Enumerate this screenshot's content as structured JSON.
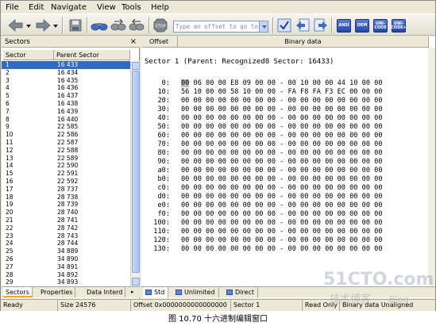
{
  "menu": {
    "file": "File",
    "edit": "Edit",
    "navigate": "Navigate",
    "view": "View",
    "tools": "Tools",
    "help": "Help"
  },
  "toolbar": {
    "offset_placeholder": "Type an offset to go to",
    "stop_label": "STOP",
    "enc_ansi": "ANSI",
    "enc_oem": "OEM",
    "enc_uni": "UNI-CODE",
    "enc_uni2": "UNI-CODE+"
  },
  "left_panel": {
    "title": "Sectors",
    "close_glyph": "×",
    "col_sector": "Sector",
    "col_parent": "Parent Sector",
    "rows": [
      {
        "sector": "1",
        "parent": "16 433"
      },
      {
        "sector": "2",
        "parent": "16 434"
      },
      {
        "sector": "3",
        "parent": "16 435"
      },
      {
        "sector": "4",
        "parent": "16 436"
      },
      {
        "sector": "5",
        "parent": "16 437"
      },
      {
        "sector": "6",
        "parent": "16 438"
      },
      {
        "sector": "7",
        "parent": "16 439"
      },
      {
        "sector": "8",
        "parent": "16 440"
      },
      {
        "sector": "9",
        "parent": "22 585"
      },
      {
        "sector": "10",
        "parent": "22 586"
      },
      {
        "sector": "11",
        "parent": "22 587"
      },
      {
        "sector": "12",
        "parent": "22 588"
      },
      {
        "sector": "13",
        "parent": "22 589"
      },
      {
        "sector": "14",
        "parent": "22 590"
      },
      {
        "sector": "15",
        "parent": "22 591"
      },
      {
        "sector": "16",
        "parent": "22 592"
      },
      {
        "sector": "17",
        "parent": "28 737"
      },
      {
        "sector": "18",
        "parent": "28 738"
      },
      {
        "sector": "19",
        "parent": "28 739"
      },
      {
        "sector": "20",
        "parent": "28 740"
      },
      {
        "sector": "21",
        "parent": "28 741"
      },
      {
        "sector": "22",
        "parent": "28 742"
      },
      {
        "sector": "23",
        "parent": "28 743"
      },
      {
        "sector": "24",
        "parent": "28 744"
      },
      {
        "sector": "25",
        "parent": "34 889"
      },
      {
        "sector": "26",
        "parent": "34 890"
      },
      {
        "sector": "27",
        "parent": "34 891"
      },
      {
        "sector": "28",
        "parent": "34 892"
      },
      {
        "sector": "29",
        "parent": "34 893"
      }
    ],
    "tabs": [
      "Sectors",
      "Properties",
      "Data Interd"
    ]
  },
  "right_panel": {
    "col_offset": "Offset",
    "col_binary": "Binary data",
    "sector_title": "Sector 1 (Parent: Recognized8 Sector: 16433)",
    "hex_rows": [
      {
        "off": "0:",
        "cursor": "00",
        "bytes": " 06 00 00 E8 09 00 00 - 00 10 00 00 44 10 00 00"
      },
      {
        "off": "10:",
        "cursor": "",
        "bytes": "56 10 00 00 58 10 00 00 - FA F8 FA F3 EC 00 00 00"
      },
      {
        "off": "20:",
        "cursor": "",
        "bytes": "00 00 00 00 00 00 00 00 - 00 00 00 00 00 00 00 00"
      },
      {
        "off": "30:",
        "cursor": "",
        "bytes": "00 00 00 00 00 00 00 00 - 00 00 00 00 00 00 00 00"
      },
      {
        "off": "40:",
        "cursor": "",
        "bytes": "00 00 00 00 00 00 00 00 - 00 00 00 00 00 00 00 00"
      },
      {
        "off": "50:",
        "cursor": "",
        "bytes": "00 00 00 00 00 00 00 00 - 00 00 00 00 00 00 00 00"
      },
      {
        "off": "60:",
        "cursor": "",
        "bytes": "00 00 00 00 00 00 00 00 - 00 00 00 00 00 00 00 00"
      },
      {
        "off": "70:",
        "cursor": "",
        "bytes": "00 00 00 00 00 00 00 00 - 00 00 00 00 00 00 00 00"
      },
      {
        "off": "80:",
        "cursor": "",
        "bytes": "00 00 00 00 00 00 00 00 - 00 00 00 00 00 00 00 00"
      },
      {
        "off": "90:",
        "cursor": "",
        "bytes": "00 00 00 00 00 00 00 00 - 00 00 00 00 00 00 00 00"
      },
      {
        "off": "a0:",
        "cursor": "",
        "bytes": "00 00 00 00 00 00 00 00 - 00 00 00 00 00 00 00 00"
      },
      {
        "off": "b0:",
        "cursor": "",
        "bytes": "00 00 00 00 00 00 00 00 - 00 00 00 00 00 00 00 00"
      },
      {
        "off": "c0:",
        "cursor": "",
        "bytes": "00 00 00 00 00 00 00 00 - 00 00 00 00 00 00 00 00"
      },
      {
        "off": "d0:",
        "cursor": "",
        "bytes": "00 00 00 00 00 00 00 00 - 00 00 00 00 00 00 00 00"
      },
      {
        "off": "e0:",
        "cursor": "",
        "bytes": "00 00 00 00 00 00 00 00 - 00 00 00 00 00 00 00 00"
      },
      {
        "off": "f0:",
        "cursor": "",
        "bytes": "00 00 00 00 00 00 00 00 - 00 00 00 00 00 00 00 00"
      },
      {
        "off": "100:",
        "cursor": "",
        "bytes": "00 00 00 00 00 00 00 00 - 00 00 00 00 00 00 00 00"
      },
      {
        "off": "110:",
        "cursor": "",
        "bytes": "00 00 00 00 00 00 00 00 - 00 00 00 00 00 00 00 00"
      },
      {
        "off": "120:",
        "cursor": "",
        "bytes": "00 00 00 00 00 00 00 00 - 00 00 00 00 00 00 00 00"
      },
      {
        "off": "130:",
        "cursor": "",
        "bytes": "00 00 00 00 00 00 00 00 - 00 00 00 00 00 00 00 00"
      }
    ],
    "tabs": [
      "Std",
      "Unlimited",
      "Direct"
    ]
  },
  "status": {
    "ready": "Ready",
    "size": "Size 24576",
    "offset": "Offset 0x0000000000000000",
    "sector": "Sector 1",
    "mode": "Read Only",
    "extra": "Binary data Unaligned"
  },
  "caption": "图 10.70    十六进制编辑窗口",
  "watermark": {
    "line1": "51CTO.com",
    "line2": "技术博客",
    "line3": "Blog"
  },
  "colors": {
    "selection": "#316ac5",
    "chrome": "#ece9d8",
    "encoding_button": "#2246a8"
  }
}
